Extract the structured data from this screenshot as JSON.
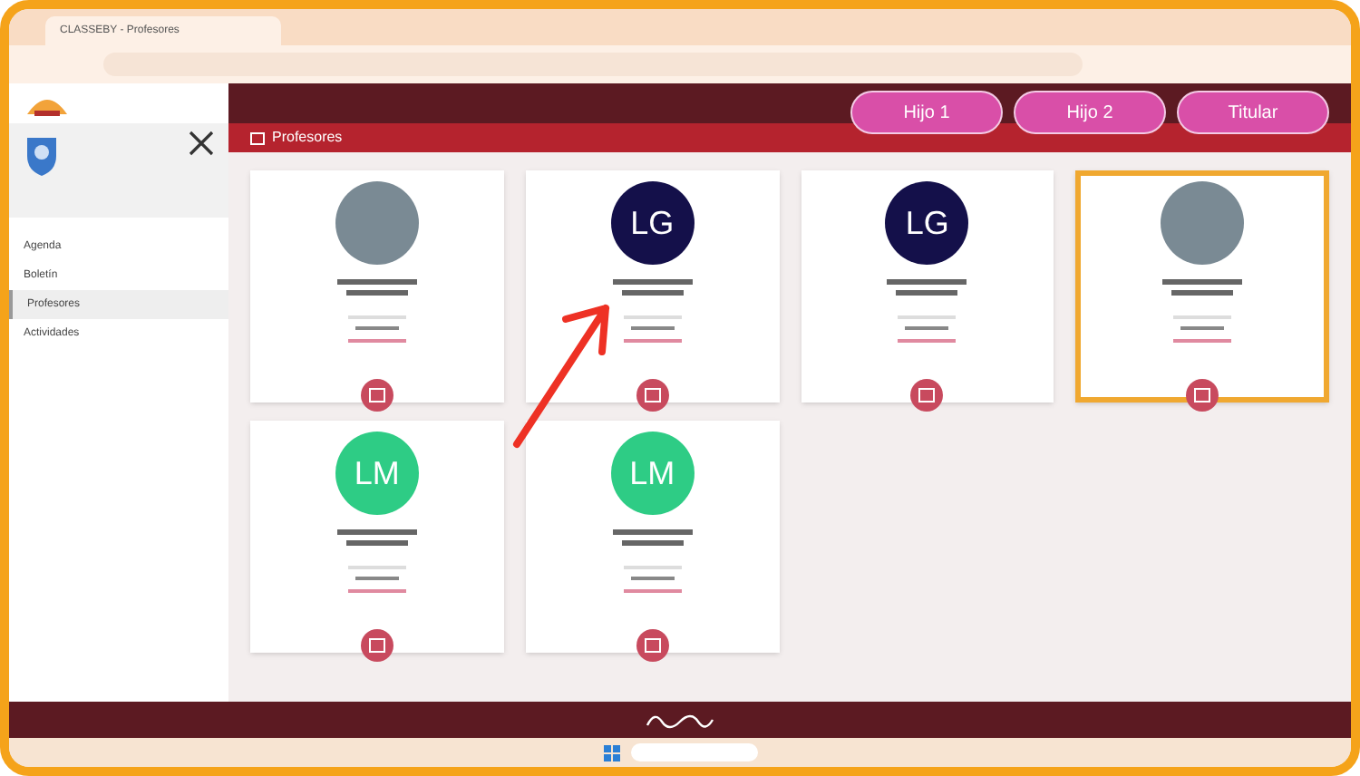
{
  "browser": {
    "tab_title": "CLASSEBY - Profesores"
  },
  "header": {
    "profile_buttons": [
      "Hijo 1",
      "Hijo 2",
      "Titular"
    ]
  },
  "sidebar": {
    "items": [
      {
        "label": "Agenda",
        "selected": false
      },
      {
        "label": "Boletín",
        "selected": false
      },
      {
        "label": "Profesores",
        "selected": true
      },
      {
        "label": "Actividades",
        "selected": false
      }
    ]
  },
  "page": {
    "title": "Profesores"
  },
  "teachers": [
    {
      "kind": "photo",
      "highlighted": false
    },
    {
      "kind": "initials",
      "initials": "LG",
      "color": "#14104a",
      "highlighted": false
    },
    {
      "kind": "initials",
      "initials": "LG",
      "color": "#14104a",
      "highlighted": false
    },
    {
      "kind": "photo",
      "highlighted": true
    },
    {
      "kind": "initials",
      "initials": "LM",
      "color": "#2ecc85",
      "highlighted": false
    },
    {
      "kind": "initials",
      "initials": "LM",
      "color": "#2ecc85",
      "highlighted": false
    }
  ]
}
